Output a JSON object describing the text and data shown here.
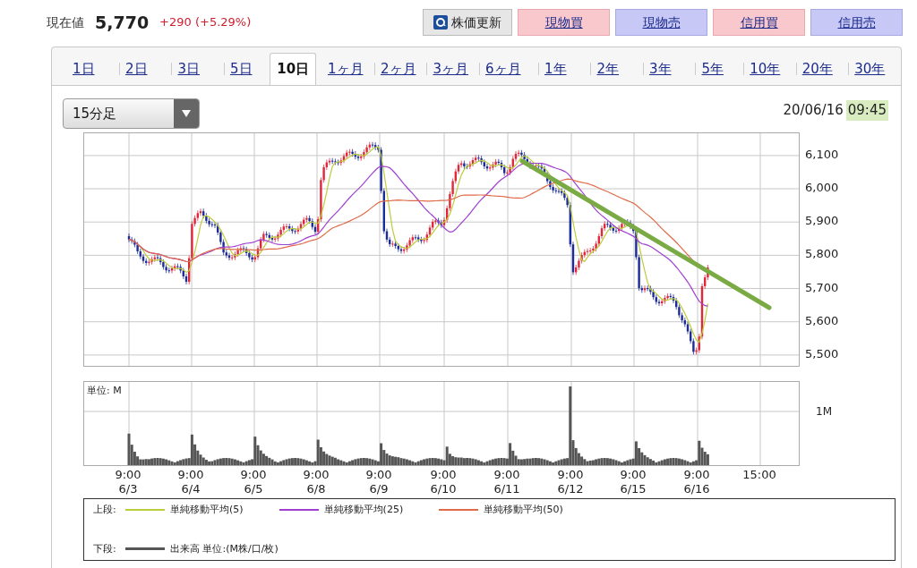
{
  "header": {
    "label": "現在値",
    "price": "5,770",
    "change": "+290 (+5.29%)"
  },
  "buttons": [
    {
      "label": "株価更新",
      "kind": "refresh"
    },
    {
      "label": "現物買",
      "kind": "buy"
    },
    {
      "label": "現物売",
      "kind": "sell"
    },
    {
      "label": "信用買",
      "kind": "buy"
    },
    {
      "label": "信用売",
      "kind": "sell"
    }
  ],
  "period_tabs": [
    {
      "label": "1日",
      "selected": false
    },
    {
      "label": "2日",
      "selected": false
    },
    {
      "label": "3日",
      "selected": false
    },
    {
      "label": "5日",
      "selected": false
    },
    {
      "label": "10日",
      "selected": true
    },
    {
      "label": "1ヶ月",
      "selected": false
    },
    {
      "label": "2ヶ月",
      "selected": false
    },
    {
      "label": "3ヶ月",
      "selected": false
    },
    {
      "label": "6ヶ月",
      "selected": false
    },
    {
      "label": "1年",
      "selected": false
    },
    {
      "label": "2年",
      "selected": false
    },
    {
      "label": "3年",
      "selected": false
    },
    {
      "label": "5年",
      "selected": false
    },
    {
      "label": "10年",
      "selected": false
    },
    {
      "label": "20年",
      "selected": false
    },
    {
      "label": "30年",
      "selected": false
    }
  ],
  "interval_select": {
    "value": "15分足"
  },
  "timestamp": {
    "date": "20/06/16",
    "time": "09:45"
  },
  "price_chart": {
    "yticks": [
      "6,100",
      "6,000",
      "5,900",
      "5,800",
      "5,700",
      "5,600",
      "5,500"
    ]
  },
  "volume_chart": {
    "unit": "単位: M",
    "tick": "1M"
  },
  "x_axis": [
    {
      "time": "9:00",
      "date": "6/3"
    },
    {
      "time": "9:00",
      "date": "6/4"
    },
    {
      "time": "9:00",
      "date": "6/5"
    },
    {
      "time": "9:00",
      "date": "6/8"
    },
    {
      "time": "9:00",
      "date": "6/9"
    },
    {
      "time": "9:00",
      "date": "6/10"
    },
    {
      "time": "9:00",
      "date": "6/11"
    },
    {
      "time": "9:00",
      "date": "6/12"
    },
    {
      "time": "9:00",
      "date": "6/15"
    },
    {
      "time": "9:00",
      "date": "6/16"
    },
    {
      "time": "15:00"
    }
  ],
  "legend": {
    "upper_label": "上段:",
    "lines": [
      {
        "label": "単純移動平均(5)",
        "color": "#bccc3a"
      },
      {
        "label": "単純移動平均(25)",
        "color": "#a040d0"
      },
      {
        "label": "単純移動平均(50)",
        "color": "#e06a48"
      }
    ],
    "lower_label": "下段:",
    "volume_label": "出来高 単位:(M株/口/枚)"
  }
}
